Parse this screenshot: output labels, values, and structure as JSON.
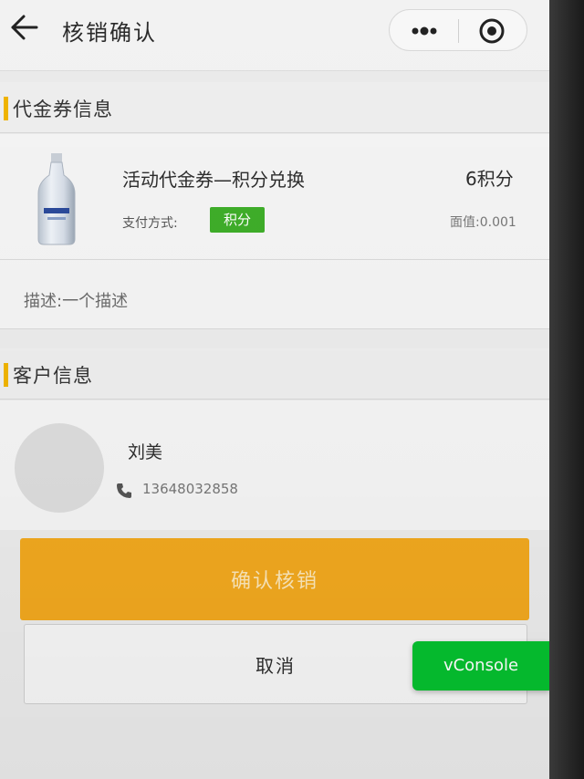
{
  "navbar": {
    "title": "核销确认",
    "back_icon": "back-arrow-icon",
    "more_icon": "more-dots-icon",
    "close_icon": "target-close-icon"
  },
  "coupon_section": {
    "heading": "代金券信息",
    "accent_color": "#f0b400",
    "item": {
      "title": "活动代金券—积分兑换",
      "points": "6积分",
      "pay_method_label": "支付方式:",
      "pay_method_badge": "积分",
      "badge_color": "#3fad29",
      "face_value": "面值:0.001"
    },
    "description": "描述:一个描述"
  },
  "customer_section": {
    "heading": "客户信息",
    "name": "刘美",
    "phone_icon": "phone-icon",
    "phone": "13648032858"
  },
  "actions": {
    "confirm_label": "确认核销",
    "confirm_color": "#f1a81f",
    "cancel_label": "取消"
  },
  "vconsole": {
    "label": "vConsole",
    "color": "#05c02f"
  }
}
